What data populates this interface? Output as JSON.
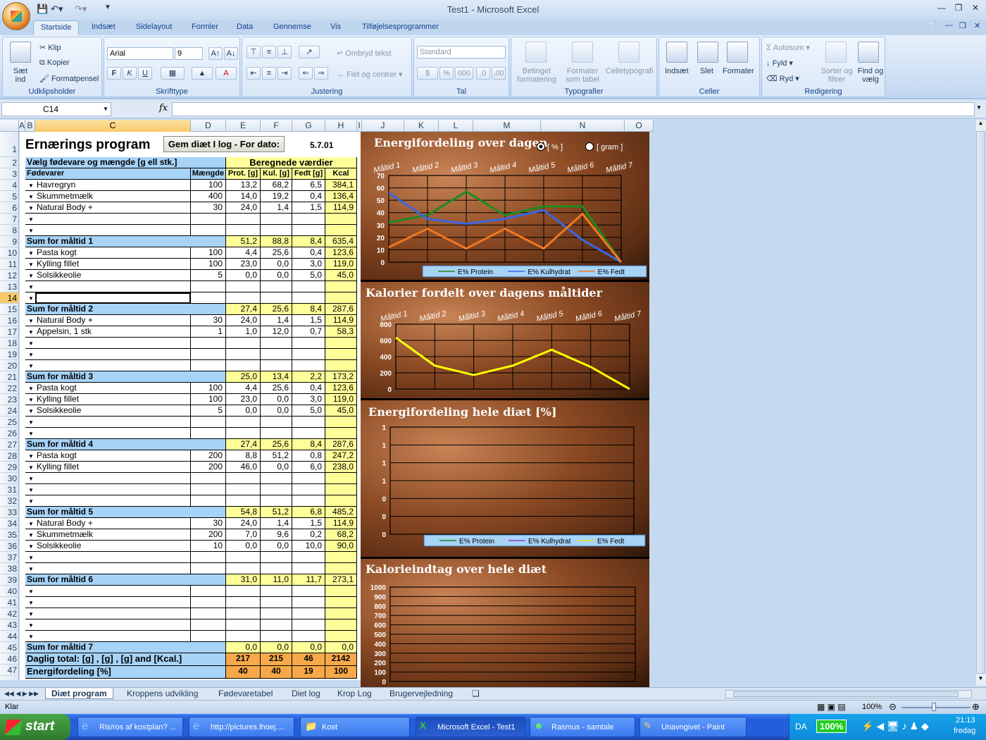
{
  "window": {
    "title": "Test1 - Microsoft Excel"
  },
  "ribbon": {
    "tabs": [
      "Startside",
      "Indsæt",
      "Sidelayout",
      "Formler",
      "Data",
      "Gennemse",
      "Vis",
      "Tilføjelsesprogrammer"
    ],
    "clipboard": {
      "paste": "Sæt ind",
      "cut": "Klip",
      "copy": "Kopier",
      "format_painter": "Formatpensel",
      "label": "Udklipsholder"
    },
    "font": {
      "name": "Arial",
      "size": "9",
      "label": "Skrifttype",
      "bold": "F",
      "italic": "K",
      "underline": "U"
    },
    "alignment": {
      "wrap": "Ombryd tekst",
      "merge": "Flet og centrer",
      "label": "Justering"
    },
    "number": {
      "format": "Standard",
      "label": "Tal",
      "percent": "%",
      "thousands": "000"
    },
    "styles": {
      "conditional": "Betinget formatering",
      "table": "Formater som tabel",
      "cellstyles": "Celletypografi",
      "label": "Typografier"
    },
    "cells": {
      "insert": "Indsæt",
      "delete": "Slet",
      "format": "Formater",
      "label": "Celler"
    },
    "editing": {
      "autosum": "Autosum",
      "fill": "Fyld",
      "clear": "Ryd",
      "sort": "Sorter og filtrer",
      "find": "Find og vælg",
      "label": "Redigering"
    }
  },
  "formula": {
    "namebox": "C14",
    "fx": "fx",
    "value": ""
  },
  "columns": [
    "A",
    "B",
    "C",
    "D",
    "E",
    "F",
    "G",
    "H",
    "I",
    "J",
    "K",
    "L",
    "M",
    "N",
    "O"
  ],
  "sheet": {
    "title": "Ernærings program",
    "save_button": "Gem diæt I log - For dato:",
    "date": "5.7.01",
    "header_select": "Vælg fødevare og mængde [g ell stk.]",
    "header_calc": "Beregnede værdier",
    "col_food": "Fødevarer",
    "col_amount": "Mængde",
    "col_prot": "Prot. [g]",
    "col_kul": "Kul. [g]",
    "col_fedt": "Fedt [g]",
    "col_kcal": "Kcal",
    "rows": [
      {
        "r": 4,
        "t": "f",
        "food": "Havregryn",
        "amt": "100",
        "p": "13,2",
        "k": "68,2",
        "f": "6,5",
        "kcal": "384,1"
      },
      {
        "r": 5,
        "t": "f",
        "food": "Skummetmælk",
        "amt": "400",
        "p": "14,0",
        "k": "19,2",
        "f": "0,4",
        "kcal": "136,4"
      },
      {
        "r": 6,
        "t": "f",
        "food": "Natural Body +",
        "amt": "30",
        "p": "24,0",
        "k": "1,4",
        "f": "1,5",
        "kcal": "114,9"
      },
      {
        "r": 7,
        "t": "f",
        "food": "",
        "amt": "",
        "p": "",
        "k": "",
        "f": "",
        "kcal": ""
      },
      {
        "r": 8,
        "t": "f",
        "food": "",
        "amt": "",
        "p": "",
        "k": "",
        "f": "",
        "kcal": ""
      },
      {
        "r": 9,
        "t": "s",
        "food": "Sum for måltid 1",
        "p": "51,2",
        "k": "88,8",
        "f": "8,4",
        "kcal": "635,4"
      },
      {
        "r": 10,
        "t": "f",
        "food": "Pasta kogt",
        "amt": "100",
        "p": "4,4",
        "k": "25,6",
        "f": "0,4",
        "kcal": "123,6"
      },
      {
        "r": 11,
        "t": "f",
        "food": "Kylling fillet",
        "amt": "100",
        "p": "23,0",
        "k": "0,0",
        "f": "3,0",
        "kcal": "119,0"
      },
      {
        "r": 12,
        "t": "f",
        "food": "Solsikkeolie",
        "amt": "5",
        "p": "0,0",
        "k": "0,0",
        "f": "5,0",
        "kcal": "45,0"
      },
      {
        "r": 13,
        "t": "f",
        "food": "",
        "amt": "",
        "p": "",
        "k": "",
        "f": "",
        "kcal": ""
      },
      {
        "r": 14,
        "t": "f",
        "food": "",
        "amt": "",
        "p": "",
        "k": "",
        "f": "",
        "kcal": ""
      },
      {
        "r": 15,
        "t": "s",
        "food": "Sum for måltid 2",
        "p": "27,4",
        "k": "25,6",
        "f": "8,4",
        "kcal": "287,6"
      },
      {
        "r": 16,
        "t": "f",
        "food": "Natural Body +",
        "amt": "30",
        "p": "24,0",
        "k": "1,4",
        "f": "1,5",
        "kcal": "114,9"
      },
      {
        "r": 17,
        "t": "f",
        "food": "Appelsin, 1 stk",
        "amt": "1",
        "p": "1,0",
        "k": "12,0",
        "f": "0,7",
        "kcal": "58,3"
      },
      {
        "r": 18,
        "t": "f",
        "food": "",
        "amt": "",
        "p": "",
        "k": "",
        "f": "",
        "kcal": ""
      },
      {
        "r": 19,
        "t": "f",
        "food": "",
        "amt": "",
        "p": "",
        "k": "",
        "f": "",
        "kcal": ""
      },
      {
        "r": 20,
        "t": "f",
        "food": "",
        "amt": "",
        "p": "",
        "k": "",
        "f": "",
        "kcal": ""
      },
      {
        "r": 21,
        "t": "s",
        "food": "Sum for måltid 3",
        "p": "25,0",
        "k": "13,4",
        "f": "2,2",
        "kcal": "173,2"
      },
      {
        "r": 22,
        "t": "f",
        "food": "Pasta kogt",
        "amt": "100",
        "p": "4,4",
        "k": "25,6",
        "f": "0,4",
        "kcal": "123,6"
      },
      {
        "r": 23,
        "t": "f",
        "food": "Kylling fillet",
        "amt": "100",
        "p": "23,0",
        "k": "0,0",
        "f": "3,0",
        "kcal": "119,0"
      },
      {
        "r": 24,
        "t": "f",
        "food": "Solsikkeolie",
        "amt": "5",
        "p": "0,0",
        "k": "0,0",
        "f": "5,0",
        "kcal": "45,0"
      },
      {
        "r": 25,
        "t": "f",
        "food": "",
        "amt": "",
        "p": "",
        "k": "",
        "f": "",
        "kcal": ""
      },
      {
        "r": 26,
        "t": "f",
        "food": "",
        "amt": "",
        "p": "",
        "k": "",
        "f": "",
        "kcal": ""
      },
      {
        "r": 27,
        "t": "s",
        "food": "Sum for måltid 4",
        "p": "27,4",
        "k": "25,6",
        "f": "8,4",
        "kcal": "287,6"
      },
      {
        "r": 28,
        "t": "f",
        "food": "Pasta kogt",
        "amt": "200",
        "p": "8,8",
        "k": "51,2",
        "f": "0,8",
        "kcal": "247,2"
      },
      {
        "r": 29,
        "t": "f",
        "food": "Kylling fillet",
        "amt": "200",
        "p": "46,0",
        "k": "0,0",
        "f": "6,0",
        "kcal": "238,0"
      },
      {
        "r": 30,
        "t": "f",
        "food": "",
        "amt": "",
        "p": "",
        "k": "",
        "f": "",
        "kcal": ""
      },
      {
        "r": 31,
        "t": "f",
        "food": "",
        "amt": "",
        "p": "",
        "k": "",
        "f": "",
        "kcal": ""
      },
      {
        "r": 32,
        "t": "f",
        "food": "",
        "amt": "",
        "p": "",
        "k": "",
        "f": "",
        "kcal": ""
      },
      {
        "r": 33,
        "t": "s",
        "food": "Sum for måltid 5",
        "p": "54,8",
        "k": "51,2",
        "f": "6,8",
        "kcal": "485,2"
      },
      {
        "r": 34,
        "t": "f",
        "food": "Natural Body +",
        "amt": "30",
        "p": "24,0",
        "k": "1,4",
        "f": "1,5",
        "kcal": "114,9"
      },
      {
        "r": 35,
        "t": "f",
        "food": "Skummetmælk",
        "amt": "200",
        "p": "7,0",
        "k": "9,6",
        "f": "0,2",
        "kcal": "68,2"
      },
      {
        "r": 36,
        "t": "f",
        "food": "Solsikkeolie",
        "amt": "10",
        "p": "0,0",
        "k": "0,0",
        "f": "10,0",
        "kcal": "90,0"
      },
      {
        "r": 37,
        "t": "f",
        "food": "",
        "amt": "",
        "p": "",
        "k": "",
        "f": "",
        "kcal": ""
      },
      {
        "r": 38,
        "t": "f",
        "food": "",
        "amt": "",
        "p": "",
        "k": "",
        "f": "",
        "kcal": ""
      },
      {
        "r": 39,
        "t": "s",
        "food": "Sum for måltid 6",
        "p": "31,0",
        "k": "11,0",
        "f": "11,7",
        "kcal": "273,1"
      },
      {
        "r": 40,
        "t": "f",
        "food": "",
        "amt": "",
        "p": "",
        "k": "",
        "f": "",
        "kcal": ""
      },
      {
        "r": 41,
        "t": "f",
        "food": "",
        "amt": "",
        "p": "",
        "k": "",
        "f": "",
        "kcal": ""
      },
      {
        "r": 42,
        "t": "f",
        "food": "",
        "amt": "",
        "p": "",
        "k": "",
        "f": "",
        "kcal": ""
      },
      {
        "r": 43,
        "t": "f",
        "food": "",
        "amt": "",
        "p": "",
        "k": "",
        "f": "",
        "kcal": ""
      },
      {
        "r": 44,
        "t": "f",
        "food": "",
        "amt": "",
        "p": "",
        "k": "",
        "f": "",
        "kcal": ""
      },
      {
        "r": 45,
        "t": "s",
        "food": "Sum for måltid 7",
        "p": "0,0",
        "k": "0,0",
        "f": "0,0",
        "kcal": "0,0"
      },
      {
        "r": 46,
        "t": "t",
        "food": "Daglig total: [g] , [g] , [g] and [Kcal.]",
        "p": "217",
        "k": "215",
        "f": "46",
        "kcal": "2142"
      },
      {
        "r": 47,
        "t": "t",
        "food": "Energifordeling  [%]",
        "p": "40",
        "k": "40",
        "f": "19",
        "kcal": "100"
      }
    ]
  },
  "chart_data": [
    {
      "type": "line",
      "title": "Energifordeling over dagen",
      "categories": [
        "Måltid 1",
        "Måltid 2",
        "Måltid 3",
        "Måltid 4",
        "Måltid 5",
        "Måltid 6",
        "Måltid 7"
      ],
      "ylim": [
        0,
        70
      ],
      "yticks": [
        0,
        10,
        20,
        30,
        40,
        50,
        60,
        70
      ],
      "radio": {
        "pct": "[ % ]",
        "gram": "[ gram ]",
        "selected": "pct"
      },
      "series": [
        {
          "name": "E% Protein",
          "color": "#1e8a1e",
          "values": [
            32,
            38,
            57,
            38,
            45,
            45,
            0
          ]
        },
        {
          "name": "E% Kulhydrat",
          "color": "#3b66e0",
          "values": [
            56,
            35,
            31,
            35,
            42,
            18,
            0
          ]
        },
        {
          "name": "E% Fedt",
          "color": "#f07820",
          "values": [
            12,
            27,
            11,
            27,
            11,
            39,
            0
          ]
        }
      ]
    },
    {
      "type": "line",
      "title": "Kalorier fordelt over dagens måltider",
      "categories": [
        "Måltid 1",
        "Måltid 2",
        "Måltid 3",
        "Måltid 4",
        "Måltid 5",
        "Måltid 6",
        "Måltid 7"
      ],
      "ylim": [
        0,
        800
      ],
      "yticks": [
        0,
        200,
        400,
        600,
        800
      ],
      "series": [
        {
          "name": "",
          "color": "#ffff00",
          "values": [
            635,
            288,
            173,
            288,
            485,
            273,
            0
          ]
        }
      ]
    },
    {
      "type": "line",
      "title": "Energifordeling hele diæt [%]",
      "yticks": [
        "0",
        "0",
        "0",
        "1",
        "1",
        "1",
        "1"
      ],
      "series": [
        {
          "name": "E% Protein",
          "color": "#1e8a1e"
        },
        {
          "name": "E% Kulhydrat",
          "color": "#8a3ad0"
        },
        {
          "name": "E% Fedt",
          "color": "#f0e020"
        }
      ]
    },
    {
      "type": "line",
      "title": "Kalorieindtag over hele diæt",
      "ylim": [
        0,
        1000
      ],
      "yticks": [
        0,
        100,
        200,
        300,
        400,
        500,
        600,
        700,
        800,
        900,
        1000
      ],
      "series": []
    }
  ],
  "sheet_tabs": [
    "Diæt program",
    "Kroppens udvikling",
    "Fødevaretabel",
    "Diet log",
    "Krop Log",
    "Brugervejledning"
  ],
  "status": {
    "ready": "Klar",
    "zoom": "100%"
  },
  "taskbar": {
    "start": "start",
    "items": [
      "Ris/ros af kostplan? ...",
      "http://pictures.lhoej....",
      "Kost",
      "Microsoft Excel - Test1",
      "Rasmus - samtale",
      "Unavngivet - Paint"
    ],
    "lang": "DA",
    "battery": "100%",
    "time": "21:13",
    "day": "fredag"
  }
}
